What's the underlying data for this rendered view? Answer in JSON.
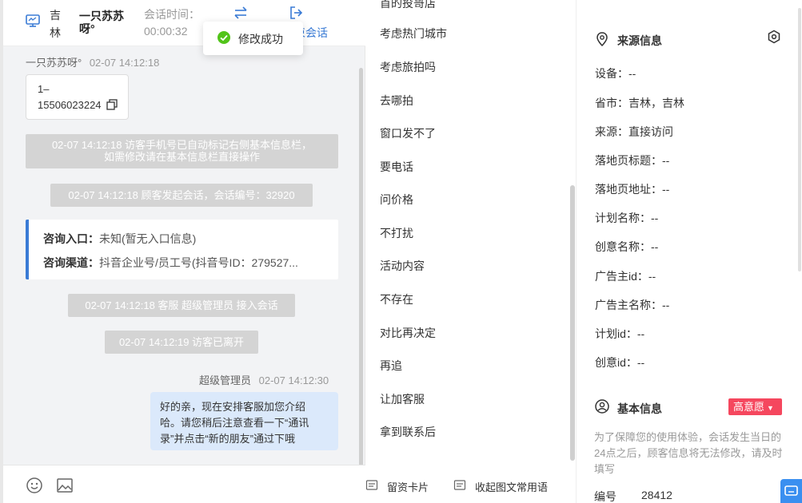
{
  "header": {
    "location": "吉林",
    "visitor_name": "一只苏苏呀°",
    "session_time_label": "会话时间：",
    "session_time": "00:00:32",
    "end_session_label": "束会话"
  },
  "toast": {
    "text": "修改成功"
  },
  "chat": {
    "visitor_meta": {
      "name": "一只苏苏呀°",
      "time": "02-07 14:12:18"
    },
    "phone_card": {
      "line1": "1–",
      "line2": "15506023224"
    },
    "system_messages": [
      "02-07 14:12:18 访客手机号已自动标记右侧基本信息栏，",
      "如需修改请在基本信息栏直接操作",
      "02-07 14:12:18 顾客发起会话，会话编号：32920",
      "02-07 14:12:18 客服 超级管理员 接入会话",
      "02-07 14:12:19 访客已离开"
    ],
    "info_card": {
      "entry_label": "咨询入口：",
      "entry_value": "未知(暂无入口信息)",
      "channel_label": "咨询渠道：",
      "channel_value": "抖音企业号/员工号(抖音号ID：279527..."
    },
    "agent_meta": {
      "name": "超级管理员",
      "time": "02-07 14:12:30"
    },
    "agent_message": {
      "line1": "好的亲，现在安排客服加您介绍",
      "line2": "哈。请您稍后注意查看一下“通讯",
      "line3": "录”并点击“新的朋友”通过下哦"
    }
  },
  "phrases": {
    "items": [
      "考虑热门城市",
      "考虑旅拍吗",
      "去哪拍",
      "窗口发不了",
      "要电话",
      "问价格",
      "不打扰",
      "活动内容",
      "不存在",
      "对比再决定",
      "再追",
      "让加客服",
      "拿到联系后"
    ],
    "bottom": {
      "lead_card": "留资卡片",
      "collapse": "收起图文常用语"
    }
  },
  "source_info": {
    "title": "来源信息",
    "fields": [
      "设备：--",
      "省市：吉林，吉林",
      "来源：直接访问",
      "落地页标题：--",
      "落地页地址：--",
      "计划名称：--",
      "创意名称：--",
      "广告主id：--",
      "广告主名称：--",
      "计划id：--",
      "创意id：--"
    ]
  },
  "basic_info": {
    "title": "基本信息",
    "intent_badge": "高意愿",
    "notice": "为了保障您的使用体验，会话发生当日的24点之后，顾客信息将无法修改，请及时填写",
    "id_label": "编号",
    "id_value": "28412"
  },
  "colors": {
    "accent": "#3a7bd5",
    "badge": "#f5475e",
    "success": "#52c41a",
    "bubble": "#dbe9fb"
  }
}
